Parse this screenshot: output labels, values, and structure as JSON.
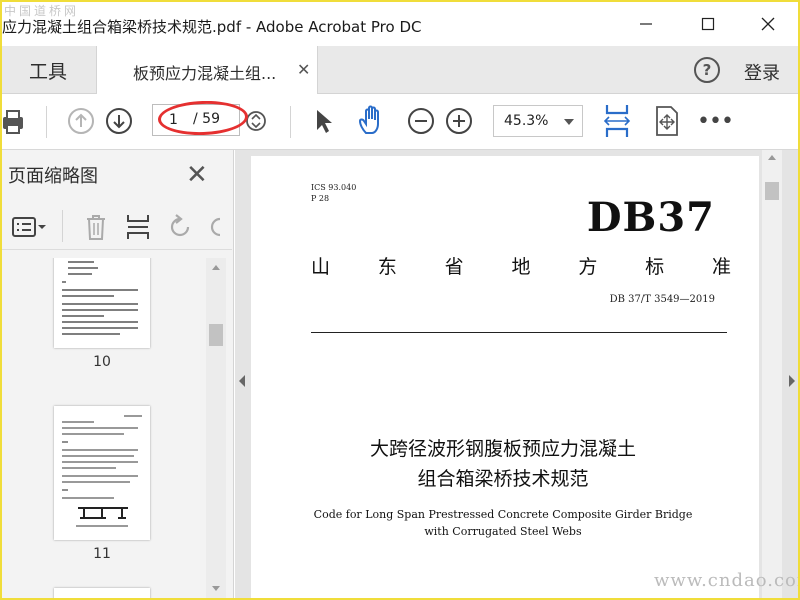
{
  "window": {
    "watermark_top": "中国道桥网",
    "title": "应力混凝土组合箱梁桥技术规范.pdf - Adobe Acrobat Pro DC"
  },
  "tabs": {
    "tools_label": "工具",
    "doc_tab_label": "板预应力混凝土组...",
    "help": "?",
    "login_label": "登录"
  },
  "toolbar": {
    "current_page": "1",
    "total_pages": "/ 59",
    "zoom": "45.3%"
  },
  "left_panel": {
    "title": "页面缩略图",
    "thumbnails": [
      {
        "page": "10"
      },
      {
        "page": "11"
      }
    ]
  },
  "document": {
    "ics": "ICS 93.040",
    "p": "P 28",
    "db_mark": "DB37",
    "province_chars": [
      "山",
      "东",
      "省",
      "地",
      "方",
      "标",
      "准"
    ],
    "std_code": "DB 37/T 3549—2019",
    "title_cn_1": "大跨径波形钢腹板预应力混凝土",
    "title_cn_2": "组合箱梁桥技术规范",
    "title_en_1": "Code for Long Span Prestressed Concrete Composite Girder Bridge",
    "title_en_2": "with Corrugated Steel Webs"
  },
  "watermark_bottom": "www.cndao.com",
  "colors": {
    "frame": "#f0dd3a",
    "highlight": "#e53030",
    "accent_blue": "#2a6dc9"
  }
}
